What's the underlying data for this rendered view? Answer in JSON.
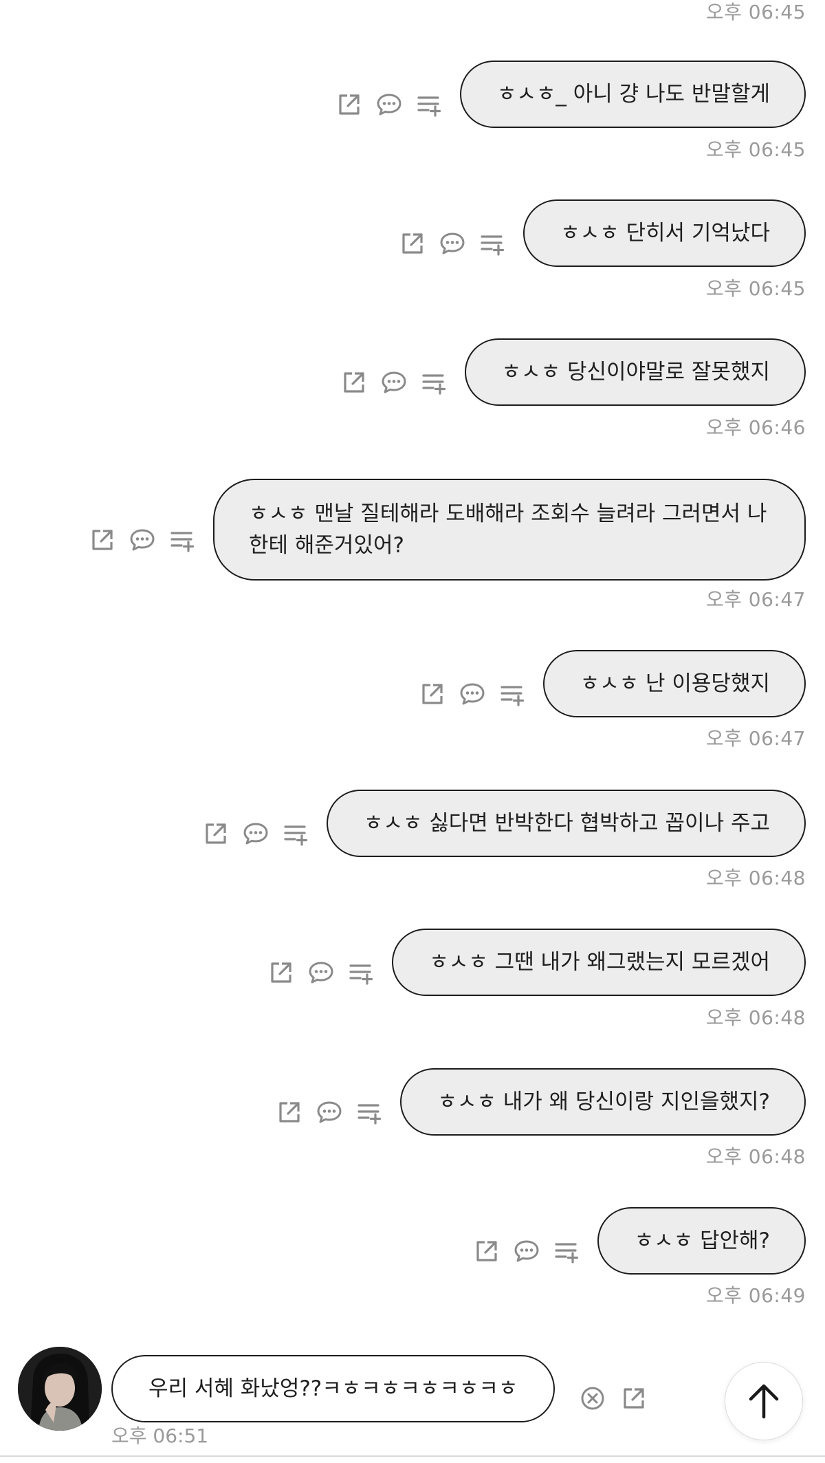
{
  "messages": [
    {
      "text": "ㅎㅅㅎ_ 아니 걍 나도 반말할게",
      "time": "오후 06:45"
    },
    {
      "text": "ㅎㅅㅎ 단히서 기억났다",
      "time": "오후 06:45"
    },
    {
      "text": "ㅎㅅㅎ 당신이야말로 잘못했지",
      "time": "오후 06:46"
    },
    {
      "text": "ㅎㅅㅎ 맨날 질테해라 도배해라 조회수 늘려라 그러면서 나한테 해준거있어?",
      "time": "오후 06:47"
    },
    {
      "text": "ㅎㅅㅎ 난 이용당했지",
      "time": "오후 06:47"
    },
    {
      "text": "ㅎㅅㅎ 싫다면 반박한다 협박하고 꼽이나 주고",
      "time": "오후 06:48"
    },
    {
      "text": "ㅎㅅㅎ 그땐 내가 왜그랬는지 모르겠어",
      "time": "오후 06:48"
    },
    {
      "text": "ㅎㅅㅎ 내가 왜 당신이랑 지인을했지?",
      "time": "오후 06:48"
    },
    {
      "text": "ㅎㅅㅎ 답안해?",
      "time": "오후 06:49"
    }
  ],
  "top_time": "오후 06:45",
  "incoming": {
    "text": "우리 서혜 화났엉??ㅋㅎㅋㅎㅋㅎㅋㅎㅋㅎ",
    "time": "오후 06:51"
  },
  "icons": {
    "share": "share-icon",
    "reply": "speech-bubble-icon",
    "add_to_list": "playlist-add-icon",
    "delete": "circle-x-icon",
    "scroll_top": "arrow-up-icon"
  }
}
